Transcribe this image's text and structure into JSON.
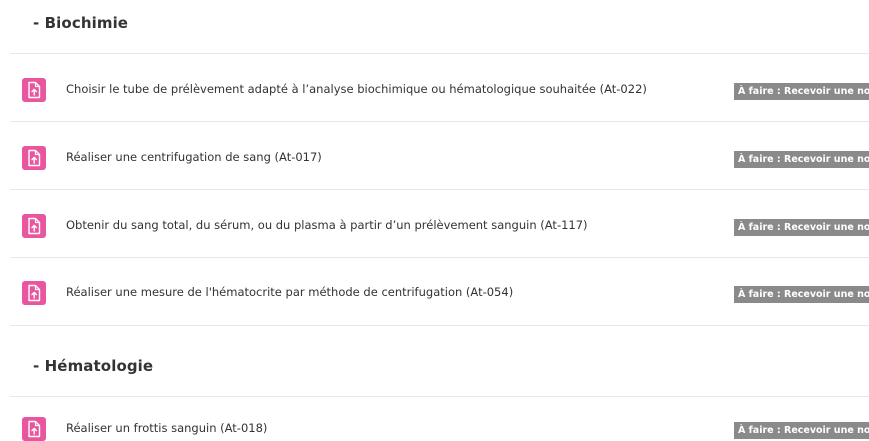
{
  "sections": [
    {
      "title": "- Biochimie",
      "activities": [
        {
          "name": "Choisir le tube de prélèvement adapté à l’analyse biochimique ou hématologique souhaitée (At-022)",
          "status": "À faire : Recevoir une note",
          "icon": "assignment-upload-icon"
        },
        {
          "name": "Réaliser une centrifugation de sang (At-017)",
          "status": "À faire : Recevoir une note",
          "icon": "assignment-upload-icon"
        },
        {
          "name": "Obtenir du sang total, du sérum, ou du plasma à partir d’un prélèvement sanguin (At-117)",
          "status": "À faire : Recevoir une note",
          "icon": "assignment-upload-icon"
        },
        {
          "name": "Réaliser une mesure de l'hématocrite par méthode de centrifugation (At-054)",
          "status": "À faire : Recevoir une note",
          "icon": "assignment-upload-icon"
        }
      ]
    },
    {
      "title": "- Hématologie",
      "activities": [
        {
          "name": "Réaliser un frottis sanguin (At-018)",
          "status": "À faire : Recevoir une note",
          "icon": "assignment-upload-icon"
        }
      ]
    }
  ],
  "colors": {
    "icon_background": "#e8569f",
    "badge_background": "#8a8a8a",
    "divider": "#e8e8e8"
  }
}
